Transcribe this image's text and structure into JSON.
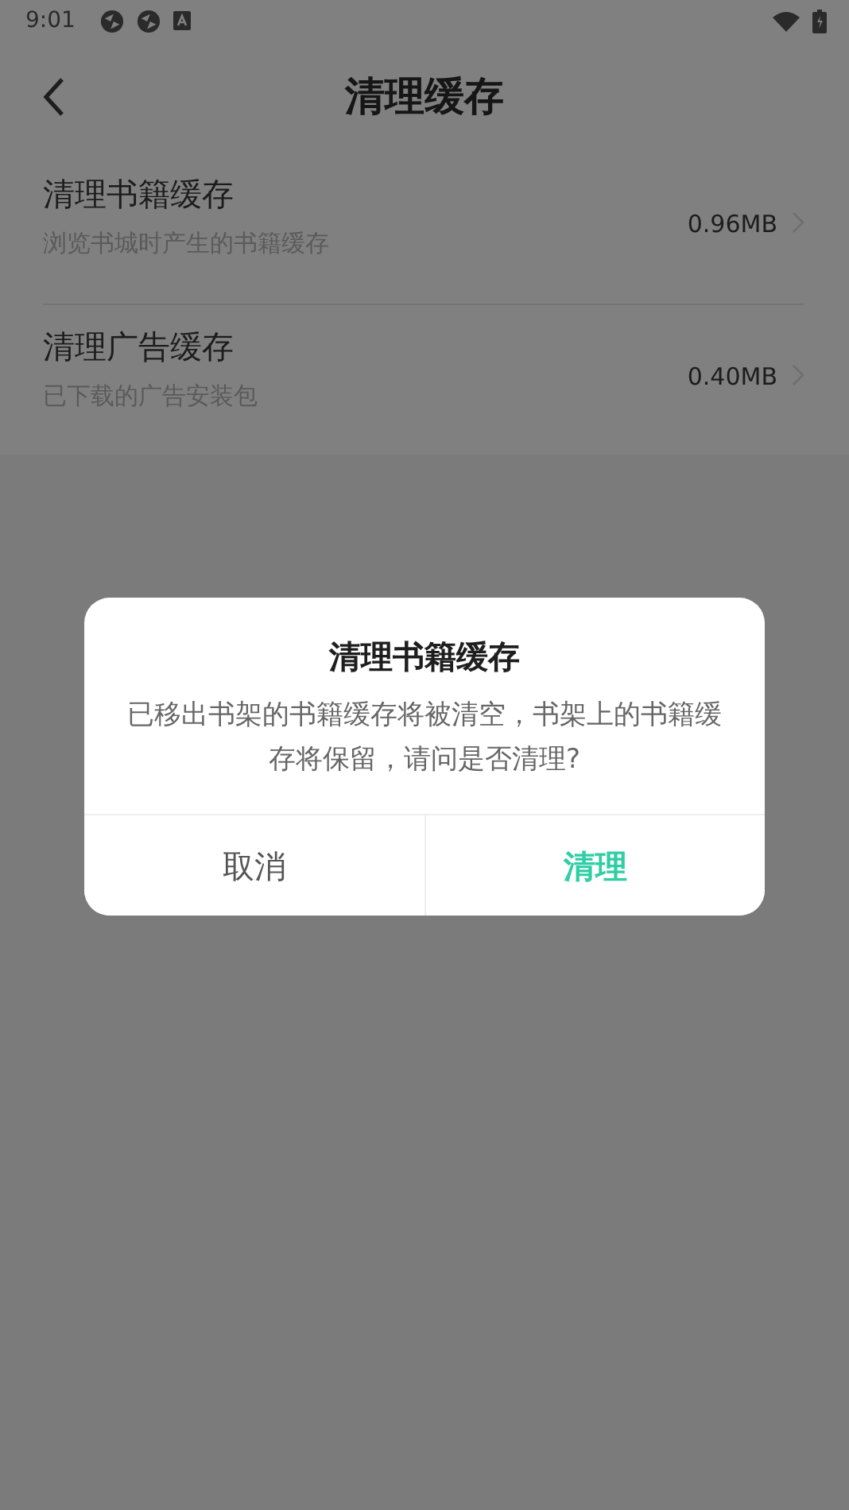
{
  "status_bar": {
    "time": "9:01"
  },
  "header": {
    "title": "清理缓存"
  },
  "cache_items": [
    {
      "title": "清理书籍缓存",
      "subtitle": "浏览书城时产生的书籍缓存",
      "size": "0.96MB"
    },
    {
      "title": "清理广告缓存",
      "subtitle": "已下载的广告安装包",
      "size": "0.40MB"
    }
  ],
  "dialog": {
    "title": "清理书籍缓存",
    "message": "已移出书架的书籍缓存将被清空，书架上的书籍缓存将保留，请问是否清理?",
    "buttons": [
      {
        "label": "取消",
        "kind": "cancel"
      },
      {
        "label": "清理",
        "kind": "confirm"
      }
    ]
  }
}
